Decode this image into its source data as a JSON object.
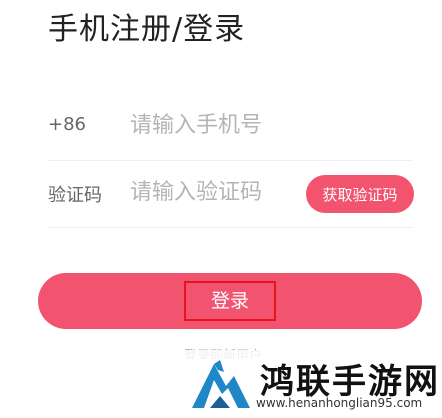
{
  "header": {
    "title": "手机注册/登录"
  },
  "form": {
    "phone": {
      "country_code": "+86",
      "placeholder": "请输入手机号",
      "value": ""
    },
    "code": {
      "label": "验证码",
      "placeholder": "请输入验证码",
      "value": "",
      "get_code_label": "获取验证码"
    },
    "login_label": "登录",
    "new_user_note": "登录即新用户"
  },
  "watermark": {
    "name": "鸿联手游网",
    "url": "www.henanhonglian95.com",
    "logo_icon": "mountain-logo-icon"
  },
  "colors": {
    "accent": "#f25470",
    "highlight_border": "#e8141b"
  }
}
